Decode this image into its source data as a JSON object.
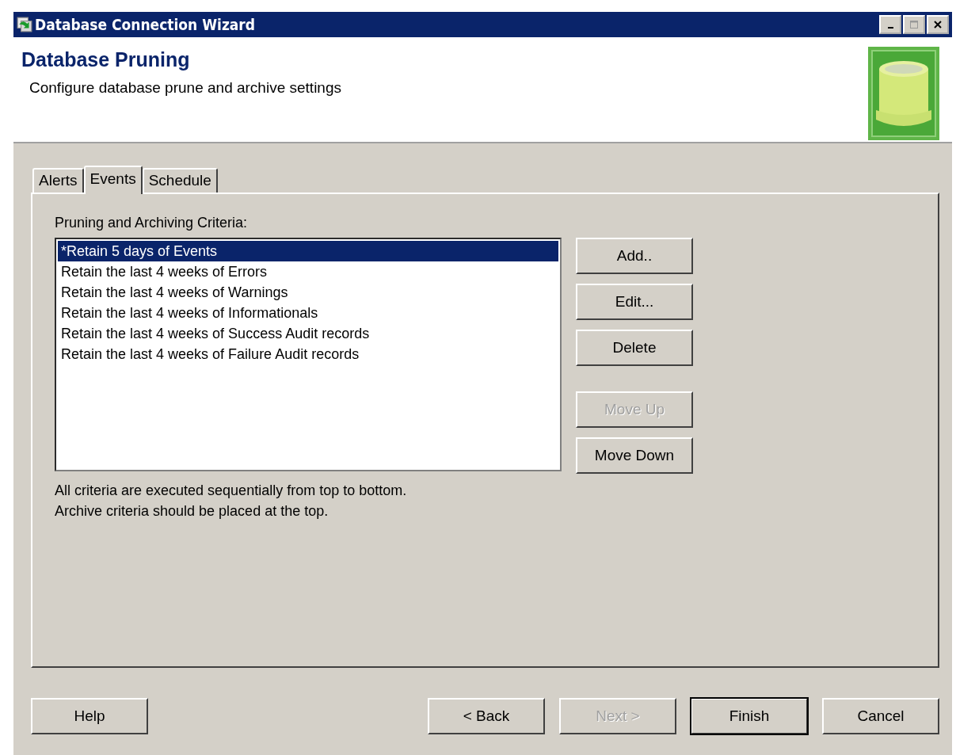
{
  "window": {
    "title": "Database Connection Wizard"
  },
  "header": {
    "title": "Database Pruning",
    "subtitle": "Configure database prune and archive settings"
  },
  "tabs": [
    {
      "label": "Alerts",
      "selected": false
    },
    {
      "label": "Events",
      "selected": true
    },
    {
      "label": "Schedule",
      "selected": false
    }
  ],
  "criteria": {
    "label": "Pruning and Archiving Criteria:",
    "items": [
      {
        "text": "*Retain 5 days of Events",
        "selected": true
      },
      {
        "text": "Retain the last 4 weeks of Errors",
        "selected": false
      },
      {
        "text": "Retain the last 4 weeks of Warnings",
        "selected": false
      },
      {
        "text": "Retain the last 4 weeks of Informationals",
        "selected": false
      },
      {
        "text": "Retain the last 4 weeks of Success Audit records",
        "selected": false
      },
      {
        "text": "Retain the last 4 weeks of Failure Audit records",
        "selected": false
      }
    ],
    "notes": [
      "All criteria are executed sequentially from top to bottom.",
      "Archive criteria should be placed at the top."
    ]
  },
  "side_buttons": [
    {
      "label": "Add..",
      "disabled": false
    },
    {
      "label": "Edit...",
      "disabled": false
    },
    {
      "label": "Delete",
      "disabled": false
    },
    {
      "label": "Move Up",
      "disabled": true
    },
    {
      "label": "Move Down",
      "disabled": false
    }
  ],
  "footer_buttons": [
    {
      "label": "Help",
      "disabled": false,
      "default": false
    },
    {
      "label": "< Back",
      "disabled": false,
      "default": false
    },
    {
      "label": "Next >",
      "disabled": true,
      "default": false
    },
    {
      "label": "Finish",
      "disabled": false,
      "default": true
    },
    {
      "label": "Cancel",
      "disabled": false,
      "default": false
    }
  ]
}
